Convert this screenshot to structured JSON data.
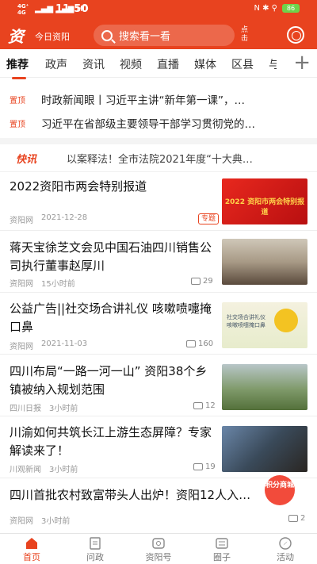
{
  "status": {
    "net": "4G⁺\n4G",
    "sig": "▂▄▆ ▂▄▆ HD",
    "time": "11:50",
    "right": "N ✱ ⚲",
    "battery": "86"
  },
  "header": {
    "logo": "资",
    "city": "今日资阳",
    "search_placeholder": "搜索看一看",
    "refresh": "点击"
  },
  "tabs": [
    "推荐",
    "政声",
    "资讯",
    "视频",
    "直播",
    "媒体",
    "区县",
    "与"
  ],
  "tabs_plus": "+",
  "pinned": [
    {
      "badge": "置顶",
      "text": "时政新闻眼丨习近平主讲“新年第一课”，…"
    },
    {
      "badge": "置顶",
      "text": "习近平在省部级主要领导干部学习贯彻党的…"
    }
  ],
  "flash": {
    "label": "快讯",
    "text": "以案释法！全市法院2021年度“十大典…"
  },
  "news": [
    {
      "title": "2022资阳市两会特别报道",
      "source": "资阳网",
      "time": "2021-12-28",
      "tag": "专题",
      "comments": "",
      "thumb_text": "2022 资阳市两会特别报道"
    },
    {
      "title": "蒋天宝徐芝文会见中国石油四川销售公司执行董事赵厚川",
      "source": "资阳网",
      "time": "15小时前",
      "tag": "",
      "comments": "29"
    },
    {
      "title": "公益广告||社交场合讲礼仪 咳嗽喷嚏掩口鼻",
      "source": "资阳网",
      "time": "2021-11-03",
      "tag": "",
      "comments": "160",
      "thumb_text": "社交场合讲礼仪 咳嗽喷嚏掩口鼻"
    },
    {
      "title": "四川布局“一路一河一山” 资阳38个乡镇被纳入规划范围",
      "source": "四川日报",
      "time": "3小时前",
      "tag": "",
      "comments": "12"
    },
    {
      "title": "川渝如何共筑长江上游生态屏障？专家解读来了！",
      "source": "川观新闻",
      "time": "3小时前",
      "tag": "",
      "comments": "19"
    },
    {
      "title": "四川首批农村致富带头人出炉！资阳12人入…",
      "source": "资阳网",
      "time": "3小时前",
      "tag": "",
      "comments": "2",
      "badge": "积分商城"
    }
  ],
  "bottom_nav": [
    {
      "label": "首页",
      "active": true
    },
    {
      "label": "问政",
      "active": false
    },
    {
      "label": "资阳号",
      "active": false
    },
    {
      "label": "圈子",
      "active": false
    },
    {
      "label": "活动",
      "active": false
    }
  ],
  "colors": {
    "brand": "#e8431f"
  }
}
